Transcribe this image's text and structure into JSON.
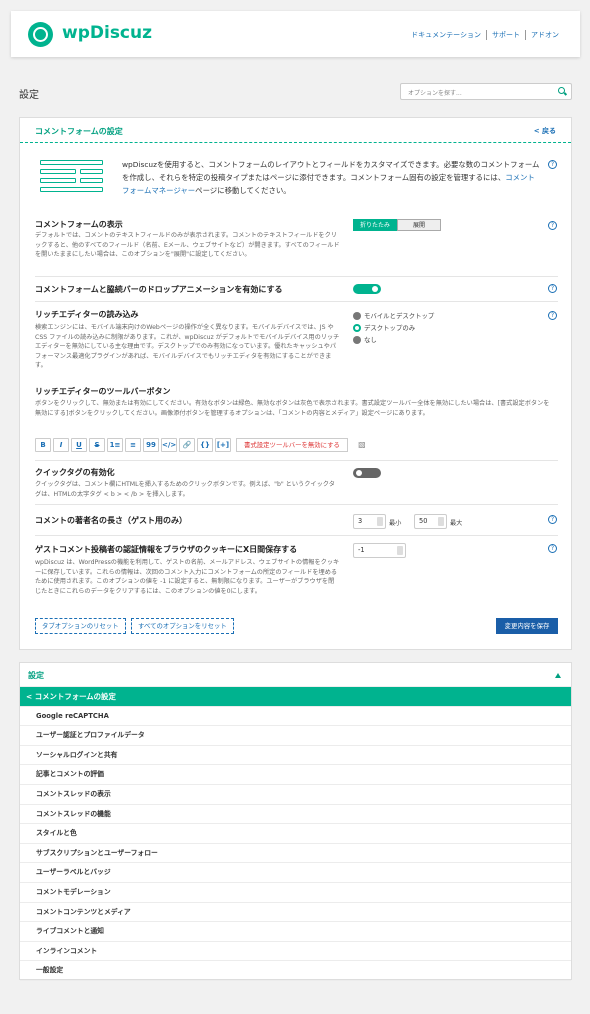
{
  "header": {
    "logo_text": "wpDiscuz",
    "links": [
      "ドキュメンテーション",
      "サポート",
      "アドオン"
    ]
  },
  "page": {
    "title": "設定",
    "search_placeholder": "オプションを探す..."
  },
  "section": {
    "title": "コメントフォームの設定",
    "back_label": "< 戻る",
    "intro_text": "wpDiscuzを使用すると、コメントフォームのレイアウトとフィールドをカスタマイズできます。必要な数のコメントフォームを作成し、それらを特定の投稿タイプまたはページに添付できます。コメントフォーム固有の設定を管理するには、",
    "intro_link": "コメントフォームマネージャー",
    "intro_suffix": "ページに移動してください。"
  },
  "options": {
    "display": {
      "title": "コメントフォームの表示",
      "desc": "デフォルトでは、コメントのテキストフィールドのみが表示されます。コメントのテキストフィールドをクリックすると、他のすべてのフィールド（名前、Eメール、ウェブサイトなど）が開きます。すべてのフィールドを開いたままにしたい場合は、このオプションを\"展開\"に設定してください。",
      "seg_on": "折りたたみ",
      "seg_off": "展開"
    },
    "dropdown_anim": {
      "title": "コメントフォームと脇続バーのドロップアニメーションを有効にする",
      "enabled": true
    },
    "rich_editor": {
      "title": "リッチエディターの読み込み",
      "desc": "検索エンジンには、モバイル端末向けのWebページの操作が全く異なります。モバイルデバイスでは、JS や CSS ファイルの読み込みに制限があります。これが、wpDiscuz がデフォルトでモバイルデバイス用のリッチエディターを無効にしている主な理由です。デスクトップでのみ有効になっています。優れたキャッシュやパフォーマンス最適化プラグインがあれば、モバイルデバイスでもリッチエディタを有効にすることができます。",
      "radios": [
        "モバイルとデスクトップ",
        "デスクトップのみ",
        "なし"
      ],
      "selected": 1
    },
    "toolbar": {
      "title": "リッチエディターのツールバーボタン",
      "desc": "ボタンをクリックして、無効または有効にしてください。有効なボタンは緑色、無効なボタンは灰色で表示されます。書式設定ツールバー全体を無効にしたい場合は、[書式設定ボタンを無効にする]ボタンをクリックしてください。画像添付ボタンを管理するオプションは、「コメントの内容とメディア」設定ページにあります。",
      "buttons": [
        "B",
        "I",
        "U",
        "S",
        "1≡",
        "≡",
        "99",
        "</>",
        "🔗",
        "{}",
        "[+]"
      ],
      "disable_label": "書式設定ツールバーを無効にする",
      "image_icon": "image-icon"
    },
    "quicktags": {
      "title": "クイックタグの有効化",
      "desc": "クイックタグは、コメント欄にHTMLを挿入するためのクリックボタンです。例えば、\"b\" というクイックタグは、HTMLの太字タグ < b > < /b > を挿入します。",
      "enabled": false
    },
    "name_length": {
      "title": "コメントの著者名の長さ（ゲスト用のみ）",
      "min": "3",
      "min_label": "最小",
      "max": "50",
      "max_label": "最大"
    },
    "cookie": {
      "title": "ゲストコメント投稿者の認証情報をブラウザのクッキーにX日間保存する",
      "desc": "wpDiscuz は、WordPressの機能を利用して、ゲストの名前、メールアドレス、ウェブサイトの情報をクッキーに保存しています。これらの情報は、次回のコメント入力にコメントフォームの所定のフィールドを埋めるために使用されます。このオプションの値を -1 に設定すると、無制限になります。ユーザーがブラウザを閉じたときにこれらのデータをクリアするには、このオプションの値を0にします。",
      "value": "-1"
    }
  },
  "actions": {
    "reset_tab": "タブオプションのリセット",
    "reset_all": "すべてのオプションをリセット",
    "save": "変更内容を保存"
  },
  "nav": {
    "title": "設定",
    "items": [
      "< コメントフォームの設定",
      "Google reCAPTCHA",
      "ユーザー認証とプロファイルデータ",
      "ソーシャルログインと共有",
      "記事とコメントの評価",
      "コメントスレッドの表示",
      "コメントスレッドの機能",
      "スタイルと色",
      "サブスクリプションとユーザーフォロー",
      "ユーザーラベルとバッジ",
      "コメントモデレーション",
      "コメントコンテンツとメディア",
      "ライブコメントと通知",
      "インラインコメント",
      "一般設定"
    ]
  },
  "colors": {
    "accent": "#00b38f",
    "link": "#1a6fb5",
    "save": "#1a5ea8",
    "danger": "#dd3333"
  }
}
